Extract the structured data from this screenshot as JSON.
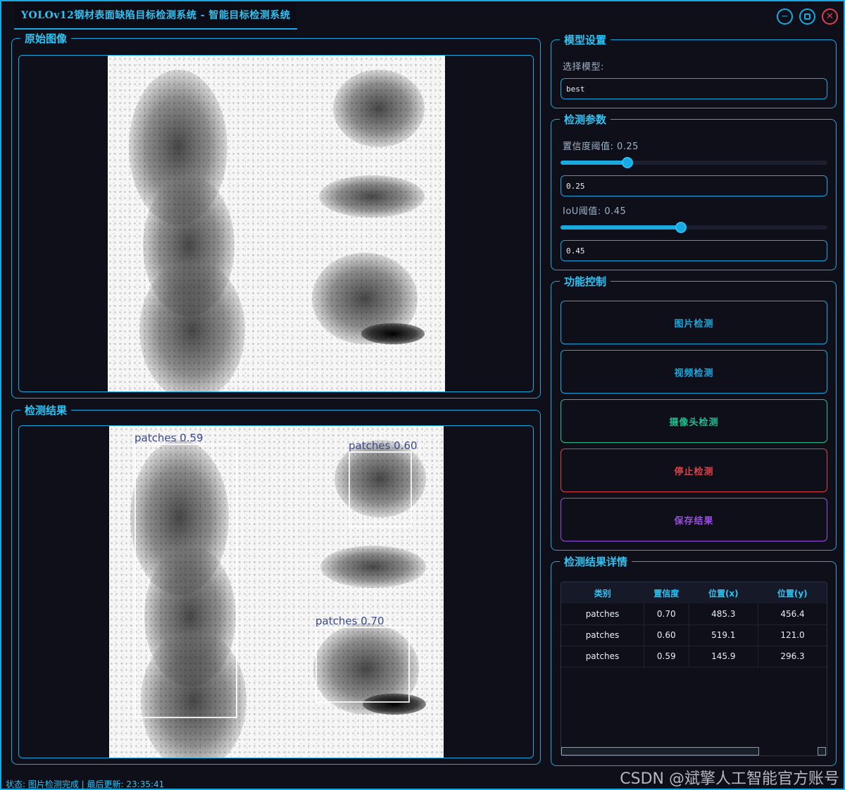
{
  "window": {
    "title": "YOLOv12钢材表面缺陷目标检测系统 - 智能目标检测系统",
    "minimize_icon": "minus-icon",
    "maximize_icon": "square-icon",
    "close_icon": "x-icon"
  },
  "original_panel": {
    "title": "原始图像"
  },
  "result_panel": {
    "title": "检测结果",
    "detections": [
      {
        "label": "patches 0.59"
      },
      {
        "label": "patches 0.60"
      },
      {
        "label": "patches 0.70"
      }
    ]
  },
  "model_settings": {
    "title": "模型设置",
    "select_label": "选择模型:",
    "selected_model": "best"
  },
  "detect_params": {
    "title": "检测参数",
    "confidence_label": "置信度阈值: 0.25",
    "confidence_value": "0.25",
    "confidence_fraction": 0.25,
    "iou_label": "IoU阈值: 0.45",
    "iou_value": "0.45",
    "iou_fraction": 0.45
  },
  "controls": {
    "title": "功能控制",
    "buttons": [
      {
        "label": "图片检测",
        "color": "#19a9e0"
      },
      {
        "label": "视频检测",
        "color": "#19a9e0"
      },
      {
        "label": "摄像头检测",
        "color": "#1fbf8f"
      },
      {
        "label": "停止检测",
        "color": "#e0404a"
      },
      {
        "label": "保存结果",
        "color": "#9a4fe0"
      }
    ]
  },
  "results_table": {
    "title": "检测结果详情",
    "columns": [
      "类别",
      "置信度",
      "位置(x)",
      "位置(y)"
    ],
    "rows": [
      [
        "patches",
        "0.70",
        "485.3",
        "456.4"
      ],
      [
        "patches",
        "0.60",
        "519.1",
        "121.0"
      ],
      [
        "patches",
        "0.59",
        "145.9",
        "296.3"
      ]
    ]
  },
  "status": {
    "text": "状态: 图片检测完成 | 最后更新: 23:35:41"
  },
  "watermark": "CSDN @斌擎人工智能官方账号",
  "colors": {
    "accent": "#19a9e0",
    "background": "#0e0f19",
    "danger": "#e0404a",
    "success": "#1fbf8f",
    "purple": "#9a4fe0"
  }
}
